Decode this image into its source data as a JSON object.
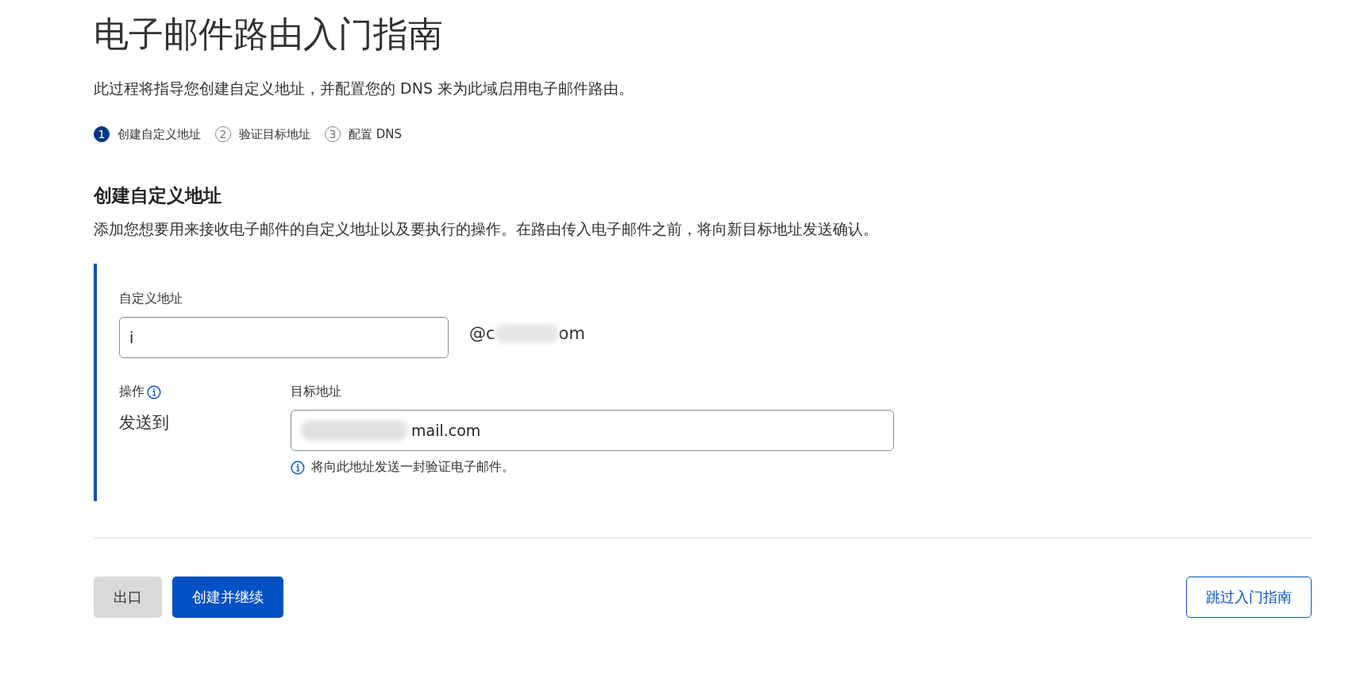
{
  "title": "电子邮件路由入门指南",
  "intro": "此过程将指导您创建自定义地址，并配置您的 DNS 来为此域启用电子邮件路由。",
  "steps": [
    {
      "number": "1",
      "label": "创建自定义地址",
      "selected": true
    },
    {
      "number": "2",
      "label": "验证目标地址",
      "selected": false
    },
    {
      "number": "3",
      "label": "配置 DNS",
      "selected": false
    }
  ],
  "section": {
    "heading": "创建自定义地址",
    "description": "添加您想要用来接收电子邮件的自定义地址以及要执行的操作。在路由传入电子邮件之前，将向新目标地址发送确认。"
  },
  "custom_address": {
    "label": "自定义地址",
    "value": "i",
    "domain_start": "@c",
    "domain_end": "om"
  },
  "action": {
    "label": "操作",
    "value": "发送到"
  },
  "destination": {
    "label": "目标地址",
    "value_end": "mail.com",
    "hint": "将向此地址发送一封验证电子邮件。"
  },
  "buttons": [
    {
      "label": "出口",
      "kind": "secondary"
    },
    {
      "label": "创建并继续",
      "kind": "primary"
    },
    {
      "label": "跳过入门指南",
      "kind": "outline"
    }
  ]
}
